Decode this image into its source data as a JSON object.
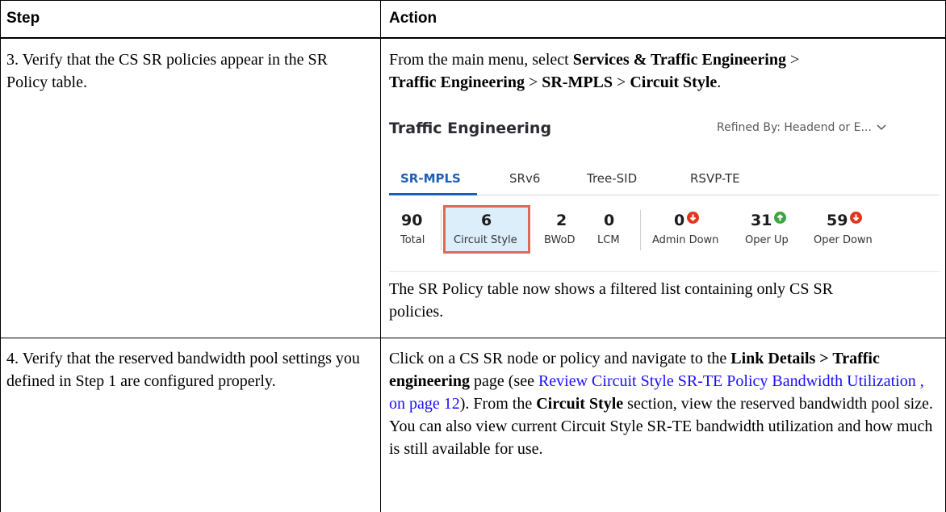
{
  "table": {
    "headers": [
      "Step",
      "Action"
    ],
    "rows": [
      {
        "step": "3. Verify that the CS SR policies appear in the SR Policy table.",
        "action_intro_1": "From the main menu, select ",
        "action_bold_1": "Services & Traffic Engineering",
        "sep": " > ",
        "action_bold_2": "Traffic Engineering",
        "action_bold_3": "SR-MPLS",
        "action_bold_4": "Circuit Style",
        "period": ".",
        "action_after": "The SR Policy table now shows a filtered list containing only CS SR policies."
      },
      {
        "step": "4. Verify that the reserved bandwidth pool settings you defined in Step 1 are configured properly.",
        "p1": "Click on a CS SR node or policy and navigate to the ",
        "b1": "Link Details > Traffic engineering",
        "p2": " page (see ",
        "link": "Review Circuit Style SR-TE Policy Bandwidth Utilization , on page 12",
        "p3": "). From the ",
        "b2": "Circuit Style",
        "p4": " section, view the reserved bandwidth pool size. You can also view current Circuit Style SR-TE bandwidth utilization and how much is still available for use."
      }
    ]
  },
  "te_panel": {
    "title": "Traffic Engineering",
    "refined_by": "Refined By: Headend or E...",
    "tabs": [
      "SR-MPLS",
      "SRv6",
      "Tree-SID",
      "RSVP-TE"
    ],
    "active_tab": "SR-MPLS",
    "stats": [
      {
        "value": "90",
        "label": "Total"
      },
      {
        "value": "6",
        "label": "Circuit Style",
        "highlighted": true
      },
      {
        "value": "2",
        "label": "BWoD"
      },
      {
        "value": "0",
        "label": "LCM"
      },
      {
        "value": "0",
        "label": "Admin Down",
        "trend": "down"
      },
      {
        "value": "31",
        "label": "Oper Up",
        "trend": "up"
      },
      {
        "value": "59",
        "label": "Oper Down",
        "trend": "down"
      }
    ]
  },
  "colors": {
    "link": "#1a0dff",
    "active_tab": "#1b5fb8",
    "highlight_border": "#e0685a",
    "highlight_fill": "#dceefa",
    "trend_down": "#e3351e",
    "trend_up": "#3ea443"
  }
}
